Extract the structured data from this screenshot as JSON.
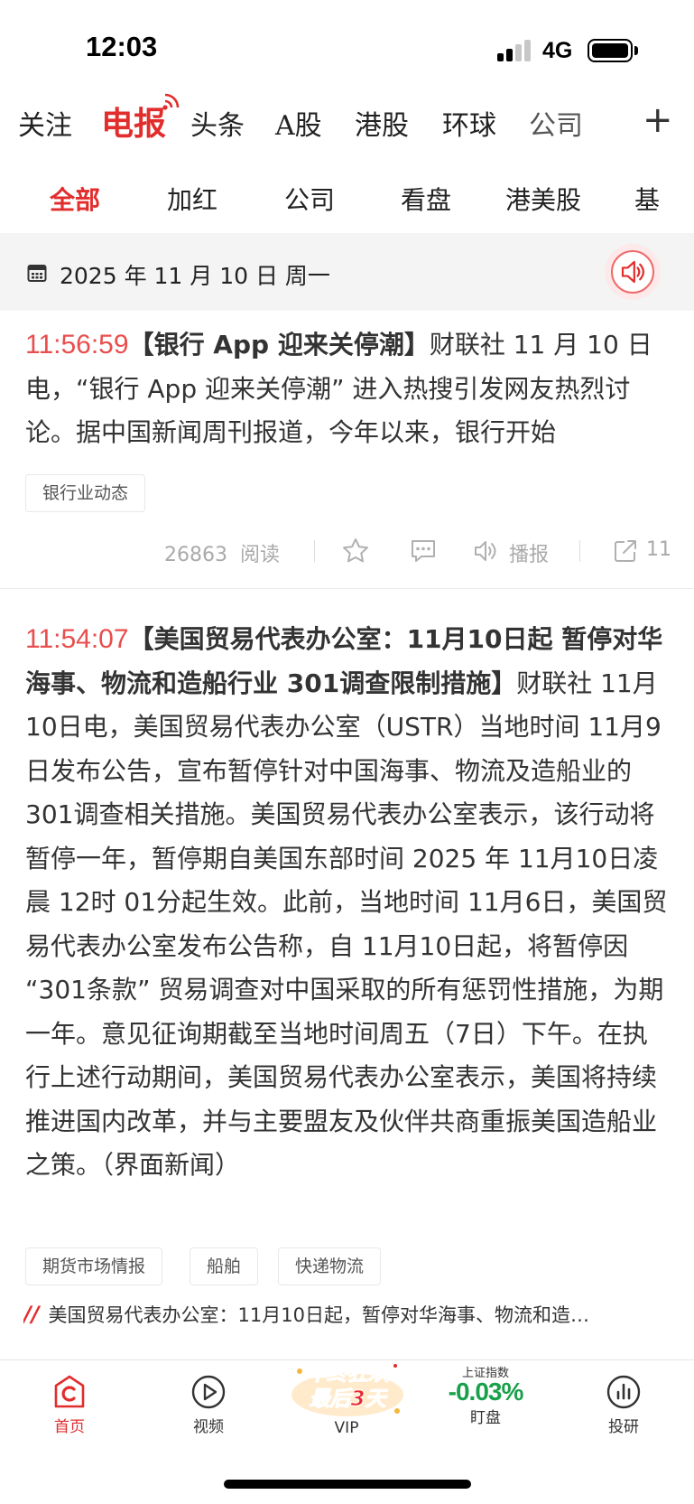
{
  "status_bar": {
    "time": "12:03",
    "network": "4G"
  },
  "top_nav": {
    "tabs": [
      {
        "label": "关注"
      },
      {
        "label": "电报"
      },
      {
        "label": "头条"
      },
      {
        "label": "A股"
      },
      {
        "label": "港股"
      },
      {
        "label": "环球"
      },
      {
        "label": "公司"
      }
    ],
    "plus": "+"
  },
  "sub_nav": {
    "tabs": [
      {
        "label": "全部"
      },
      {
        "label": "加红"
      },
      {
        "label": "公司"
      },
      {
        "label": "看盘"
      },
      {
        "label": "港美股"
      },
      {
        "label": "基"
      }
    ]
  },
  "date_bar": {
    "date": "2025 年 11 月 10 日  周一"
  },
  "news": [
    {
      "time": "11:56:59",
      "title": "【银行 App 迎来关停潮】",
      "body": "财联社 11 月 10 日电，“银行 App 迎来关停潮” 进入热搜引发网友热烈讨论。据中国新闻周刊报道，今年以来，银行开始",
      "tags": [
        "银行业动态"
      ],
      "reads": "26863",
      "reads_label": "阅读",
      "broadcast_label": "播报",
      "share_count": "11"
    },
    {
      "time": "11:54:07",
      "title": "【美国贸易代表办公室：11月10日起 暂停对华海事、物流和造船行业 301调查限制措施】",
      "body": "财联社 11月10日电，美国贸易代表办公室（USTR）当地时间 11月9日发布公告，宣布暂停针对中国海事、物流及造船业的 301调查相关措施。美国贸易代表办公室表示，该行动将暂停一年，暂停期自美国东部时间 2025 年 11月10日凌晨 12时 01分起生效。此前，当地时间 11月6日，美国贸易代表办公室发布公告称，自 11月10日起，将暂停因 “301条款” 贸易调查对中国采取的所有惩罚性措施，为期一年。意见征询期截至当地时间周五（7日）下午。在执行上述行动期间，美国贸易代表办公室表示，美国将持续推进国内改革，并与主要盟友及伙伴共商重振美国造船业之策。（界面新闻）",
      "tags": [
        "期货市场情报",
        "船舶",
        "快递物流"
      ],
      "related": "美国贸易代表办公室：11月10日起，暂停对华海事、物流和造…"
    }
  ],
  "tab_bar": {
    "home": "首页",
    "video": "视频",
    "vip": "VIP",
    "vip_badge_line1": "年终狂欢",
    "vip_badge_line2": "最后3天",
    "index_name": "上证指数",
    "index_value": "-0.03%",
    "watch": "盯盘",
    "research": "投研"
  },
  "colors": {
    "accent": "#e22d2d",
    "time_red": "#e84e4e",
    "index_green": "#19a04b"
  }
}
